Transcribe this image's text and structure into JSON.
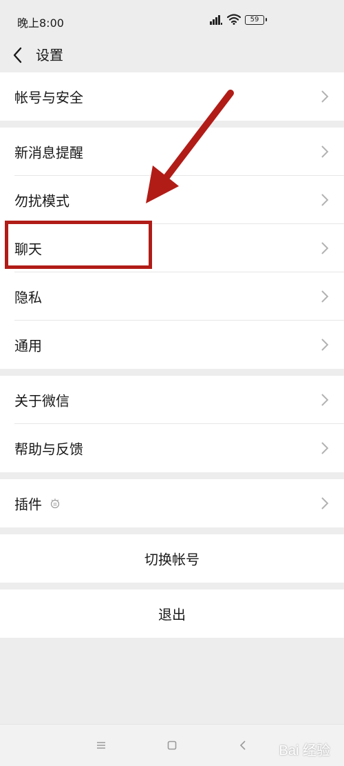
{
  "status_bar": {
    "time": "晚上8:00",
    "battery": "59",
    "icons": [
      "signal-icon",
      "wifi-icon",
      "battery-icon"
    ]
  },
  "header": {
    "title": "设置",
    "back_icon": "chevron-left-icon"
  },
  "groups": [
    {
      "items": [
        {
          "label": "帐号与安全"
        }
      ]
    },
    {
      "items": [
        {
          "label": "新消息提醒"
        },
        {
          "label": "勿扰模式"
        },
        {
          "label": "聊天"
        },
        {
          "label": "隐私"
        },
        {
          "label": "通用"
        }
      ]
    },
    {
      "items": [
        {
          "label": "关于微信"
        },
        {
          "label": "帮助与反馈"
        }
      ]
    },
    {
      "items": [
        {
          "label": "插件"
        }
      ]
    }
  ],
  "actions": {
    "switch_account": "切换帐号",
    "logout": "退出"
  },
  "annotation": {
    "highlighted_item": "聊天",
    "color": "#b11c17"
  },
  "watermark": "Bai 经验",
  "colors": {
    "background": "#ededed",
    "row_background": "#ffffff",
    "text": "#191919",
    "chevron": "#b2b2b2"
  }
}
